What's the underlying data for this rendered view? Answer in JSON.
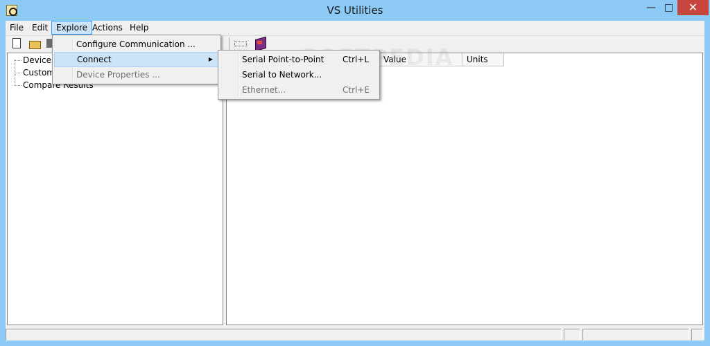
{
  "window": {
    "title": "VS Utilities",
    "minimize_glyph": "—",
    "maximize_glyph": "□",
    "close_glyph": "✕"
  },
  "menubar": {
    "items": [
      {
        "label": "File"
      },
      {
        "label": "Edit"
      },
      {
        "label": "Explore"
      },
      {
        "label": "Actions"
      },
      {
        "label": "Help"
      }
    ]
  },
  "toolbar": {
    "icons": [
      "new-document-icon",
      "open-folder-icon",
      "save-icon",
      "grid-icon",
      "book-icon"
    ]
  },
  "tree": {
    "items": [
      {
        "label": "Devices"
      },
      {
        "label": "Custom"
      },
      {
        "label": "Compare Results"
      }
    ]
  },
  "list": {
    "columns": [
      {
        "label": "Value"
      },
      {
        "label": "Units"
      }
    ]
  },
  "explore_menu": {
    "items": [
      {
        "label": "Configure Communication ...",
        "enabled": true
      },
      {
        "label": "Connect",
        "enabled": true,
        "submenu": true
      },
      {
        "label": "Device Properties ...",
        "enabled": false
      }
    ]
  },
  "connect_submenu": {
    "items": [
      {
        "label": "Serial Point-to-Point",
        "shortcut": "Ctrl+L",
        "enabled": true
      },
      {
        "label": "Serial to Network...",
        "shortcut": "",
        "enabled": true
      },
      {
        "label": "Ethernet...",
        "shortcut": "Ctrl+E",
        "enabled": false
      }
    ]
  },
  "watermark": "SOFTPEDIA",
  "colors": {
    "titlebar": "#8cc9f5",
    "close_button": "#c7453c",
    "menu_highlight": "#cce4f7",
    "menu_highlight_border": "#3399ff"
  }
}
